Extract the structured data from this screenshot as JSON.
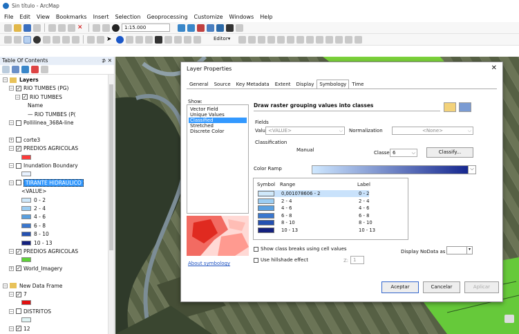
{
  "window": {
    "title": "Sin título - ArcMap"
  },
  "menu": [
    "File",
    "Edit",
    "View",
    "Bookmarks",
    "Insert",
    "Selection",
    "Geoprocessing",
    "Customize",
    "Windows",
    "Help"
  ],
  "toolbar": {
    "scale": "1:15.000",
    "editor": "Editor▾"
  },
  "toc": {
    "title": "Table Of Contents",
    "pin": "⊅ ✕",
    "rows": [
      {
        "t": "Layers",
        "lvl": 0,
        "exp": "−",
        "bold": true,
        "folder": true
      },
      {
        "t": "RIO TUMBES (PG)",
        "lvl": 1,
        "exp": "−",
        "cb": "✓"
      },
      {
        "t": "RIO TUMBES",
        "lvl": 2,
        "exp": "−",
        "cb": "✓"
      },
      {
        "t": "Name",
        "lvl": 4
      },
      {
        "t": "— RIO TUMBES (P(",
        "lvl": 4
      },
      {
        "t": "Pollilinea_368A-line",
        "lvl": 1,
        "exp": "−",
        "cb": ""
      },
      {
        "t": "",
        "lvl": 3
      },
      {
        "t": "corte3",
        "lvl": 1,
        "exp": "+",
        "cb": ""
      },
      {
        "t": "PREDIOS AGRICOLAS",
        "lvl": 1,
        "exp": "−",
        "cb": "✓"
      },
      {
        "t": "",
        "lvl": 3,
        "sw": "#ff3b3b"
      },
      {
        "t": "Inundation Boundary",
        "lvl": 1,
        "exp": "−",
        "cb": ""
      },
      {
        "t": "",
        "lvl": 3,
        "sw": "#e8f2ff"
      },
      {
        "t": "TIRANTE HIDRAULICO",
        "lvl": 1,
        "exp": "−",
        "cb": "",
        "sel": true
      },
      {
        "t": "<VALUE>",
        "lvl": 3
      },
      {
        "t": "0 - 2",
        "lvl": 3,
        "sw": "#cfe8fa"
      },
      {
        "t": "2 - 4",
        "lvl": 3,
        "sw": "#9ccdf2"
      },
      {
        "t": "4 - 6",
        "lvl": 3,
        "sw": "#5aa0e0"
      },
      {
        "t": "6 - 8",
        "lvl": 3,
        "sw": "#3977cf"
      },
      {
        "t": "8 - 10",
        "lvl": 3,
        "sw": "#2451b2"
      },
      {
        "t": "10 - 13",
        "lvl": 3,
        "sw": "#14217f"
      },
      {
        "t": "PREDIOS AGRICOLAS",
        "lvl": 1,
        "exp": "−",
        "cb": "✓"
      },
      {
        "t": "",
        "lvl": 3,
        "sw": "#5ed338"
      },
      {
        "t": "World_Imagery",
        "lvl": 1,
        "exp": "+",
        "cb": "✓"
      },
      {
        "t": "",
        "lvl": 0
      },
      {
        "t": "New Data Frame",
        "lvl": 0,
        "exp": "−",
        "folder": true
      },
      {
        "t": "7",
        "lvl": 1,
        "exp": "−",
        "cb": "✓"
      },
      {
        "t": "",
        "lvl": 3,
        "sw": "#e01010"
      },
      {
        "t": "DISTRITOS",
        "lvl": 1,
        "exp": "−",
        "cb": ""
      },
      {
        "t": "",
        "lvl": 3,
        "sw": "#e0f4f4"
      },
      {
        "t": "12",
        "lvl": 1,
        "exp": "−",
        "cb": "✓"
      }
    ]
  },
  "dialog": {
    "title": "Layer Properties",
    "close": "✕",
    "tabs": [
      "General",
      "Source",
      "Key Metadata",
      "Extent",
      "Display",
      "Symbology",
      "Time"
    ],
    "active_tab": "Symbology",
    "show_label": "Show:",
    "show_items": [
      "Vector Field",
      "Unique Values",
      "Classified",
      "Stretched",
      "Discrete Color"
    ],
    "show_selected": "Classified",
    "heading": "Draw raster grouping values into classes",
    "fields_label": "Fields",
    "value_label": "Value",
    "value_sel": "<VALUE>",
    "norm_label": "Normalization",
    "norm_sel": "<None>",
    "class_label": "Classification",
    "class_method": "Manual",
    "classes_label": "Classes",
    "classes_val": "6",
    "classify_btn": "Classify...",
    "ramp_label": "Color Ramp",
    "col_symbol": "Symbol",
    "col_range": "Range",
    "col_label": "Label",
    "classes": [
      {
        "color": "#cfe8fa",
        "range": "0,001078606 - 2",
        "label": "0 - 2"
      },
      {
        "color": "#9ccdf2",
        "range": "2 - 4",
        "label": "2 - 4"
      },
      {
        "color": "#5aa0e0",
        "range": "4 - 6",
        "label": "4 - 6"
      },
      {
        "color": "#3977cf",
        "range": "6 - 8",
        "label": "6 - 8"
      },
      {
        "color": "#2451b2",
        "range": "8 - 10",
        "label": "8 - 10"
      },
      {
        "color": "#14217f",
        "range": "10 - 13",
        "label": "10 - 13"
      }
    ],
    "show_breaks": "Show class breaks using cell values",
    "hillshade": "Use hillshade effect",
    "z_label": "Z:",
    "z_val": "1",
    "nodata_label": "Display NoData as",
    "about": "About symbology",
    "ok": "Aceptar",
    "cancel": "Cancelar",
    "apply": "Aplicar"
  }
}
